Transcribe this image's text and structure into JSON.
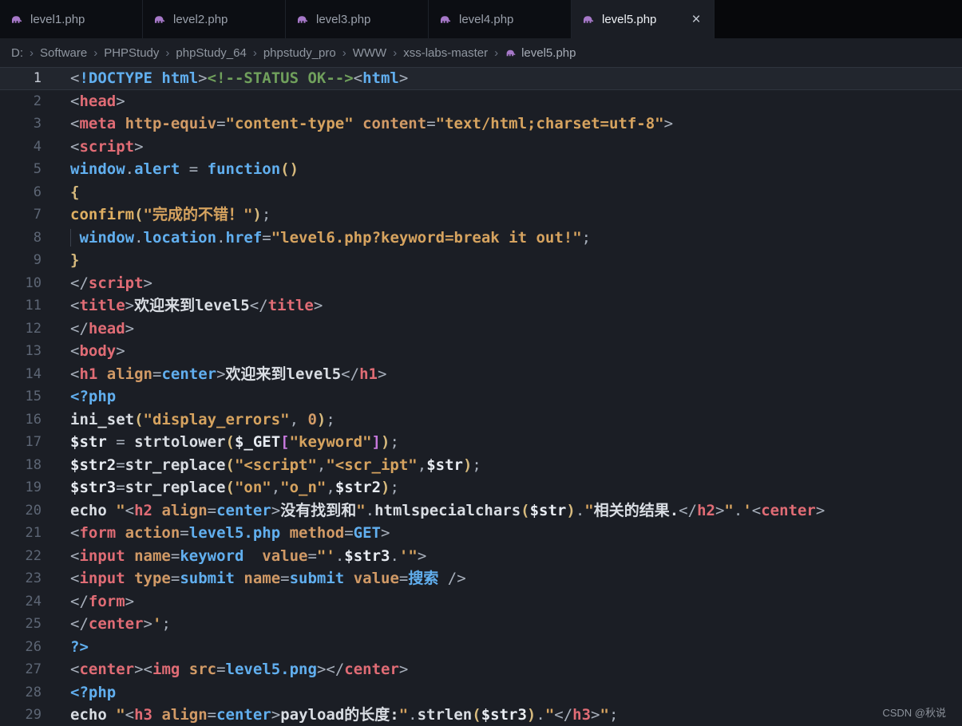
{
  "tab_bar": {
    "tabs": [
      {
        "label": "level1.php",
        "active": false
      },
      {
        "label": "level2.php",
        "active": false
      },
      {
        "label": "level3.php",
        "active": false
      },
      {
        "label": "level4.php",
        "active": false
      },
      {
        "label": "level5.php",
        "active": true,
        "close_icon": "×"
      }
    ]
  },
  "breadcrumb": {
    "separator": "›",
    "items": [
      "D:",
      "Software",
      "PHPStudy",
      "phpStudy_64",
      "phpstudy_pro",
      "WWW",
      "xss-labs-master"
    ],
    "file": "level5.php"
  },
  "watermark": "CSDN @秋说",
  "colors": {
    "background": "#1b1e25",
    "tab_bar_background": "#07080b",
    "tag_red": "#e06c75",
    "attr_orange": "#d19a66",
    "string_gold": "#d6a35f",
    "keyword_blue": "#61afef",
    "comment_green": "#70a05c",
    "brace_gold": "#d7ba7d",
    "bracket_purple": "#c678dd",
    "php_icon_purple": "#a678c8"
  },
  "editor": {
    "lines": [
      {
        "n": "1",
        "current": true,
        "tokens": [
          [
            "p",
            "<"
          ],
          [
            "blue",
            "!DOCTYPE"
          ],
          [
            "blue",
            " html"
          ],
          [
            "p",
            ">"
          ],
          [
            "cmt",
            "<!--STATUS OK-->"
          ],
          [
            "p",
            "<"
          ],
          [
            "blue",
            "html"
          ],
          [
            "p",
            ">"
          ]
        ]
      },
      {
        "n": "2",
        "tokens": [
          [
            "p",
            "<"
          ],
          [
            "tag",
            "head"
          ],
          [
            "p",
            ">"
          ]
        ]
      },
      {
        "n": "3",
        "tokens": [
          [
            "p",
            "<"
          ],
          [
            "tag",
            "meta"
          ],
          [
            "attr",
            " http-equiv"
          ],
          [
            "p",
            "="
          ],
          [
            "str",
            "\"content-type\""
          ],
          [
            "attr",
            " content"
          ],
          [
            "p",
            "="
          ],
          [
            "str",
            "\"text/html;charset=utf-8\""
          ],
          [
            "p",
            ">"
          ]
        ]
      },
      {
        "n": "4",
        "tokens": [
          [
            "p",
            "<"
          ],
          [
            "tag",
            "script"
          ],
          [
            "p",
            ">"
          ]
        ]
      },
      {
        "n": "5",
        "tokens": [
          [
            "blue",
            "window"
          ],
          [
            "p",
            "."
          ],
          [
            "blue",
            "alert"
          ],
          [
            "p",
            " = "
          ],
          [
            "blue",
            "function"
          ],
          [
            "brace",
            "()"
          ]
        ]
      },
      {
        "n": "6",
        "tokens": [
          [
            "brace",
            "{"
          ]
        ]
      },
      {
        "n": "7",
        "tokens": [
          [
            "fn2",
            "confirm"
          ],
          [
            "brace",
            "("
          ],
          [
            "str",
            "\"完成的不错！\""
          ],
          [
            "brace",
            ")"
          ],
          [
            "p",
            ";"
          ]
        ]
      },
      {
        "n": "8",
        "tokens": [
          [
            "ig",
            " "
          ],
          [
            "blue",
            "window"
          ],
          [
            "p",
            "."
          ],
          [
            "blue",
            "location"
          ],
          [
            "p",
            "."
          ],
          [
            "blue",
            "href"
          ],
          [
            "p",
            "="
          ],
          [
            "str",
            "\"level6.php?keyword=break it out!\""
          ],
          [
            "p",
            ";"
          ]
        ]
      },
      {
        "n": "9",
        "tokens": [
          [
            "brace",
            "}"
          ]
        ]
      },
      {
        "n": "10",
        "tokens": [
          [
            "p",
            "</"
          ],
          [
            "tag",
            "script"
          ],
          [
            "p",
            ">"
          ]
        ]
      },
      {
        "n": "11",
        "tokens": [
          [
            "p",
            "<"
          ],
          [
            "tag",
            "title"
          ],
          [
            "p",
            ">"
          ],
          [
            "txt",
            "欢迎来到level5"
          ],
          [
            "p",
            "</"
          ],
          [
            "tag",
            "title"
          ],
          [
            "p",
            ">"
          ]
        ]
      },
      {
        "n": "12",
        "tokens": [
          [
            "p",
            "</"
          ],
          [
            "tag",
            "head"
          ],
          [
            "p",
            ">"
          ]
        ]
      },
      {
        "n": "13",
        "tokens": [
          [
            "p",
            "<"
          ],
          [
            "tag",
            "body"
          ],
          [
            "p",
            ">"
          ]
        ]
      },
      {
        "n": "14",
        "tokens": [
          [
            "p",
            "<"
          ],
          [
            "tag",
            "h1"
          ],
          [
            "attr",
            " align"
          ],
          [
            "p",
            "="
          ],
          [
            "blue",
            "center"
          ],
          [
            "p",
            ">"
          ],
          [
            "txt",
            "欢迎来到level5"
          ],
          [
            "p",
            "</"
          ],
          [
            "tag",
            "h1"
          ],
          [
            "p",
            ">"
          ]
        ]
      },
      {
        "n": "15",
        "tokens": [
          [
            "blue",
            "<?php"
          ]
        ]
      },
      {
        "n": "16",
        "tokens": [
          [
            "fn",
            "ini_set"
          ],
          [
            "brace",
            "("
          ],
          [
            "str",
            "\"display_errors\""
          ],
          [
            "p",
            ", "
          ],
          [
            "num",
            "0"
          ],
          [
            "brace",
            ")"
          ],
          [
            "p",
            ";"
          ]
        ]
      },
      {
        "n": "17",
        "tokens": [
          [
            "var",
            "$str"
          ],
          [
            "p",
            " = "
          ],
          [
            "fn",
            "strtolower"
          ],
          [
            "brace",
            "("
          ],
          [
            "var",
            "$_GET"
          ],
          [
            "brk",
            "["
          ],
          [
            "str",
            "\"keyword\""
          ],
          [
            "brk",
            "]"
          ],
          [
            "brace",
            ")"
          ],
          [
            "p",
            ";"
          ]
        ]
      },
      {
        "n": "18",
        "tokens": [
          [
            "var",
            "$str2"
          ],
          [
            "p",
            "="
          ],
          [
            "fn",
            "str_replace"
          ],
          [
            "brace",
            "("
          ],
          [
            "str",
            "\"<script\""
          ],
          [
            "p",
            ","
          ],
          [
            "str",
            "\"<scr_ipt\""
          ],
          [
            "p",
            ","
          ],
          [
            "var",
            "$str"
          ],
          [
            "brace",
            ")"
          ],
          [
            "p",
            ";"
          ]
        ]
      },
      {
        "n": "19",
        "tokens": [
          [
            "var",
            "$str3"
          ],
          [
            "p",
            "="
          ],
          [
            "fn",
            "str_replace"
          ],
          [
            "brace",
            "("
          ],
          [
            "str",
            "\"on\""
          ],
          [
            "p",
            ","
          ],
          [
            "str",
            "\"o_n\""
          ],
          [
            "p",
            ","
          ],
          [
            "var",
            "$str2"
          ],
          [
            "brace",
            ")"
          ],
          [
            "p",
            ";"
          ]
        ]
      },
      {
        "n": "20",
        "tokens": [
          [
            "fn",
            "echo "
          ],
          [
            "str",
            "\""
          ],
          [
            "p",
            "<"
          ],
          [
            "tag",
            "h2"
          ],
          [
            "attr",
            " align"
          ],
          [
            "p",
            "="
          ],
          [
            "blue",
            "center"
          ],
          [
            "p",
            ">"
          ],
          [
            "txt",
            "没有找到和"
          ],
          [
            "str",
            "\""
          ],
          [
            "p",
            "."
          ],
          [
            "fn",
            "htmlspecialchars"
          ],
          [
            "brace",
            "("
          ],
          [
            "var",
            "$str"
          ],
          [
            "brace",
            ")"
          ],
          [
            "p",
            "."
          ],
          [
            "str",
            "\""
          ],
          [
            "txt",
            "相关的结果."
          ],
          [
            "p",
            "</"
          ],
          [
            "tag",
            "h2"
          ],
          [
            "p",
            ">"
          ],
          [
            "str",
            "\""
          ],
          [
            "p",
            "."
          ],
          [
            "str",
            "'"
          ],
          [
            "p",
            "<"
          ],
          [
            "tag",
            "center"
          ],
          [
            "p",
            ">"
          ]
        ]
      },
      {
        "n": "21",
        "tokens": [
          [
            "p",
            "<"
          ],
          [
            "tag",
            "form"
          ],
          [
            "attr",
            " action"
          ],
          [
            "p",
            "="
          ],
          [
            "blue",
            "level5.php"
          ],
          [
            "attr",
            " method"
          ],
          [
            "p",
            "="
          ],
          [
            "blue",
            "GET"
          ],
          [
            "p",
            ">"
          ]
        ]
      },
      {
        "n": "22",
        "tokens": [
          [
            "p",
            "<"
          ],
          [
            "tag",
            "input"
          ],
          [
            "attr",
            " name"
          ],
          [
            "p",
            "="
          ],
          [
            "blue",
            "keyword"
          ],
          [
            "attr",
            "  value"
          ],
          [
            "p",
            "="
          ],
          [
            "str",
            "\"'"
          ],
          [
            "p",
            "."
          ],
          [
            "var",
            "$str3"
          ],
          [
            "p",
            "."
          ],
          [
            "str",
            "'\""
          ],
          [
            "p",
            ">"
          ]
        ]
      },
      {
        "n": "23",
        "tokens": [
          [
            "p",
            "<"
          ],
          [
            "tag",
            "input"
          ],
          [
            "attr",
            " type"
          ],
          [
            "p",
            "="
          ],
          [
            "blue",
            "submit"
          ],
          [
            "attr",
            " name"
          ],
          [
            "p",
            "="
          ],
          [
            "blue",
            "submit"
          ],
          [
            "attr",
            " value"
          ],
          [
            "p",
            "="
          ],
          [
            "blue",
            "搜索"
          ],
          [
            "p",
            " />"
          ]
        ]
      },
      {
        "n": "24",
        "tokens": [
          [
            "p",
            "</"
          ],
          [
            "tag",
            "form"
          ],
          [
            "p",
            ">"
          ]
        ]
      },
      {
        "n": "25",
        "tokens": [
          [
            "p",
            "</"
          ],
          [
            "tag",
            "center"
          ],
          [
            "p",
            ">"
          ],
          [
            "str",
            "'"
          ],
          [
            "p",
            ";"
          ]
        ]
      },
      {
        "n": "26",
        "tokens": [
          [
            "blue",
            "?>"
          ]
        ]
      },
      {
        "n": "27",
        "tokens": [
          [
            "p",
            "<"
          ],
          [
            "tag",
            "center"
          ],
          [
            "p",
            ">"
          ],
          [
            "p",
            "<"
          ],
          [
            "tag",
            "img"
          ],
          [
            "attr",
            " src"
          ],
          [
            "p",
            "="
          ],
          [
            "blue",
            "level5.png"
          ],
          [
            "p",
            ">"
          ],
          [
            "p",
            "</"
          ],
          [
            "tag",
            "center"
          ],
          [
            "p",
            ">"
          ]
        ]
      },
      {
        "n": "28",
        "tokens": [
          [
            "blue",
            "<?php"
          ]
        ]
      },
      {
        "n": "29",
        "tokens": [
          [
            "fn",
            "echo "
          ],
          [
            "str",
            "\""
          ],
          [
            "p",
            "<"
          ],
          [
            "tag",
            "h3"
          ],
          [
            "attr",
            " align"
          ],
          [
            "p",
            "="
          ],
          [
            "blue",
            "center"
          ],
          [
            "p",
            ">"
          ],
          [
            "txt",
            "payload的长度:"
          ],
          [
            "str",
            "\""
          ],
          [
            "p",
            "."
          ],
          [
            "fn",
            "strlen"
          ],
          [
            "brace",
            "("
          ],
          [
            "var",
            "$str3"
          ],
          [
            "brace",
            ")"
          ],
          [
            "p",
            "."
          ],
          [
            "str",
            "\""
          ],
          [
            "p",
            "</"
          ],
          [
            "tag",
            "h3"
          ],
          [
            "p",
            ">"
          ],
          [
            "str",
            "\""
          ],
          [
            "p",
            ";"
          ]
        ]
      }
    ]
  }
}
